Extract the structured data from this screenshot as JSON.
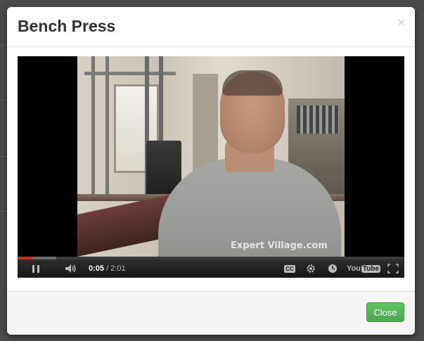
{
  "modal": {
    "title": "Bench Press",
    "close_symbol": "×"
  },
  "video": {
    "watermark": "Expert Village.com",
    "current_time": "0:05",
    "separator": " / ",
    "duration": "2:01",
    "played_fraction": 0.04,
    "loaded_fraction": 0.1,
    "icons": {
      "pause": "pause-icon",
      "volume": "volume-icon",
      "captions": "cc-icon",
      "settings": "gear-icon",
      "watch_later": "clock-icon",
      "brand": "youtube-icon",
      "fullscreen": "fullscreen-icon"
    },
    "cc_label": "CC",
    "youtube_you": "You",
    "youtube_tube": "Tube"
  },
  "footer": {
    "close_label": "Close"
  },
  "colors": {
    "close_button": "#5cb85c",
    "progress_played": "#c4302b",
    "title_text": "#333333"
  }
}
